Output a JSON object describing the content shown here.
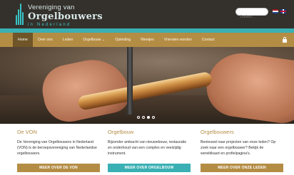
{
  "header": {
    "logo_line1": "Vereniging van",
    "logo_line2": "Orgelbouwers",
    "logo_line3": "in Nederland",
    "search_placeholder": "Zoeken..."
  },
  "nav": {
    "items": [
      {
        "label": "Home",
        "active": true
      },
      {
        "label": "Over ons"
      },
      {
        "label": "Leden"
      },
      {
        "label": "Orgelbouw ⌄"
      },
      {
        "label": "Opleiding"
      },
      {
        "label": "Weetjes"
      },
      {
        "label": "Vrienden worden"
      },
      {
        "label": "Contact"
      }
    ]
  },
  "hero": {
    "slides_total": 4,
    "active_slide": 3
  },
  "columns": [
    {
      "title": "De VON",
      "text": "De Vereniging van Orgelbouwers in Nederland (VON) is de beroepsvereniging van Nederlandse orgelbouwers.",
      "button": "MEER OVER DE VON"
    },
    {
      "title": "Orgelbouw",
      "text": "Bijzonder ambacht van nieuwebouw, restauratie en onderhoud van een complex en veelzijdig instrument.",
      "button": "MEER OVER ORGELBOUW"
    },
    {
      "title": "Orgelbouwers",
      "text": "Benieuwd naar projecten van onze leden? Op zoek naar een orgelbouwer? Bekijk de wereldkaart en profielpagina's.",
      "button": "MEER OVER ONZE LEDEN"
    }
  ],
  "colors": {
    "header_bg": "#34302b",
    "accent_teal": "#3ab0b4",
    "accent_gold": "#b48d45",
    "nav_active": "#6f5527"
  }
}
